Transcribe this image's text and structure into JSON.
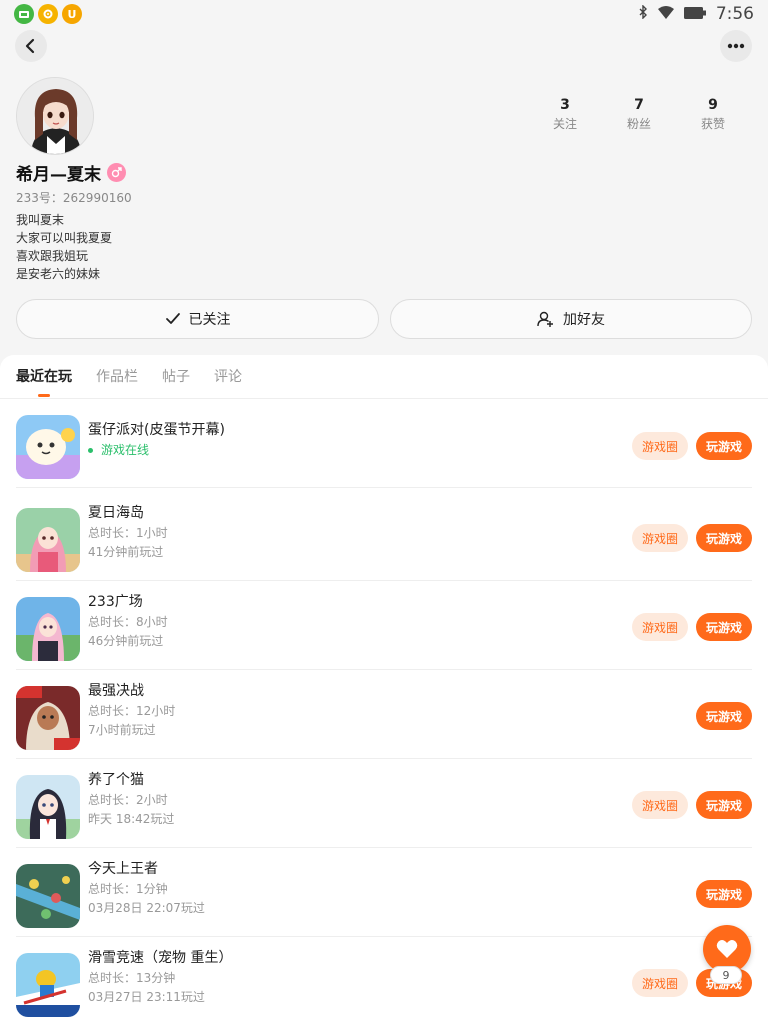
{
  "status_bar": {
    "time": "7:56",
    "app_badges": [
      {
        "icon": "green-app-icon",
        "color": "#44b744",
        "text": ""
      },
      {
        "icon": "gear-app-icon",
        "color": "#f6b300",
        "text": ""
      },
      {
        "icon": "u-app-icon",
        "color": "#f6a600",
        "text": "U"
      }
    ]
  },
  "header": {
    "back_icon": "back-arrow-icon",
    "more_icon": "more-dots-icon"
  },
  "profile": {
    "name": "希月—夏末",
    "uid": "233号：262990160",
    "bio": [
      "我叫夏末",
      "大家可以叫我夏夏",
      "喜欢跟我姐玩",
      "是安老六的妹妹"
    ],
    "stats": [
      {
        "value": "3",
        "label": "关注"
      },
      {
        "value": "7",
        "label": "粉丝"
      },
      {
        "value": "9",
        "label": "获赞"
      }
    ],
    "follow_button": "已关注",
    "add_friend_button": "加好友"
  },
  "tabs": [
    {
      "label": "最近在玩",
      "active": true
    },
    {
      "label": "作品栏",
      "active": false
    },
    {
      "label": "帖子",
      "active": false
    },
    {
      "label": "评论",
      "active": false
    }
  ],
  "games": [
    {
      "name": "蛋仔派对(皮蛋节开幕)",
      "line1": "游戏在线",
      "line2": "",
      "online": true,
      "circle": "游戏圈",
      "play": "玩游戏"
    },
    {
      "name": "夏日海岛",
      "line1": "总时长：1小时",
      "line2": "41分钟前玩过",
      "online": false,
      "circle": "游戏圈",
      "play": "玩游戏"
    },
    {
      "name": "233广场",
      "line1": "总时长：8小时",
      "line2": "46分钟前玩过",
      "online": false,
      "circle": "游戏圈",
      "play": "玩游戏"
    },
    {
      "name": "最强决战",
      "line1": "总时长：12小时",
      "line2": "7小时前玩过",
      "online": false,
      "circle": "",
      "play": "玩游戏"
    },
    {
      "name": "养了个猫",
      "line1": "总时长：2小时",
      "line2": "昨天 18:42玩过",
      "online": false,
      "circle": "游戏圈",
      "play": "玩游戏"
    },
    {
      "name": "今天上王者",
      "line1": "总时长：1分钟",
      "line2": "03月28日 22:07玩过",
      "online": false,
      "circle": "",
      "play": "玩游戏"
    },
    {
      "name": "滑雪竞速（宠物 重生）",
      "line1": "总时长：13分钟",
      "line2": "03月27日 23:11玩过",
      "online": false,
      "circle": "游戏圈",
      "play": "玩游戏"
    }
  ],
  "fab": {
    "icon": "heart-icon",
    "count": "9"
  },
  "colors": {
    "accent": "#ff6a1a",
    "accent_light": "#fde9dc",
    "online": "#2bbf6b"
  }
}
